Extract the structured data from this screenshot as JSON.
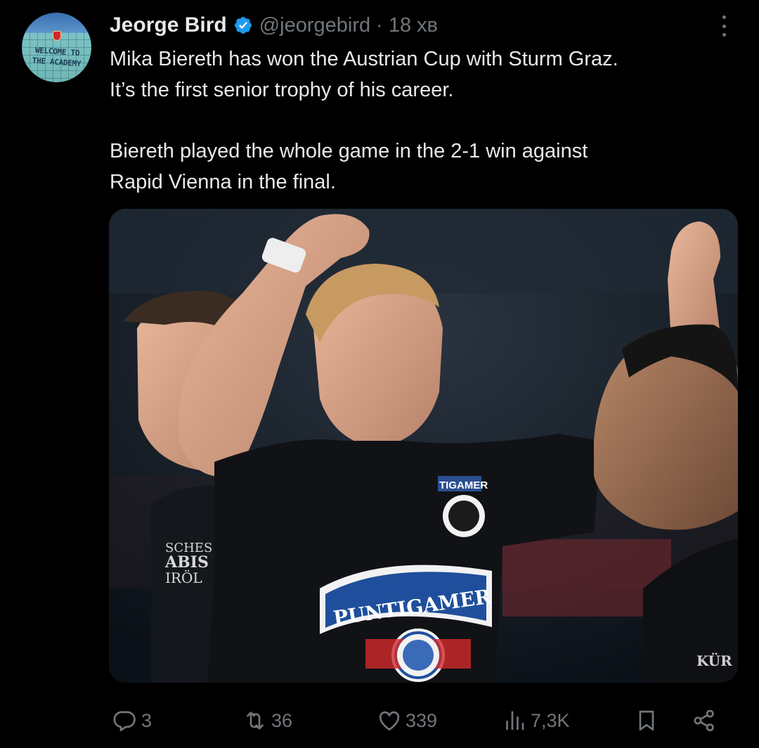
{
  "tweet": {
    "author_name": "Jeorge Bird",
    "handle": "@jeorgebird",
    "separator": "·",
    "time": "18 хв",
    "avatar_sign_line1": "WELCOME TO",
    "avatar_sign_line2": "THE ACADEMY",
    "paragraph1_line1": "Mika Biereth has won the Austrian Cup with Sturm Graz.",
    "paragraph1_line2": "It’s the first senior trophy of his career.",
    "paragraph2_line1": "Biereth played the whole game in the 2-1 win against",
    "paragraph2_line2": "Rapid Vienna in the final."
  },
  "media": {
    "shirt_sponsor": "PUNTIGAMER",
    "sleeve_sponsor": "TIGAMER",
    "left_player_text_1": "SCHES",
    "left_player_text_2": "ABIS",
    "left_player_text_3": "IRÖL",
    "right_player_text": "KÜR"
  },
  "actions": {
    "replies": "3",
    "retweets": "36",
    "likes": "339",
    "views": "7,3K"
  },
  "colors": {
    "background": "#000000",
    "text_primary": "#e7e9ea",
    "text_secondary": "#71767b",
    "verified_blue": "#1d9bf0"
  },
  "icons": [
    "verified-badge-icon",
    "more-icon",
    "reply-icon",
    "retweet-icon",
    "like-icon",
    "views-icon",
    "bookmark-icon",
    "share-icon"
  ]
}
